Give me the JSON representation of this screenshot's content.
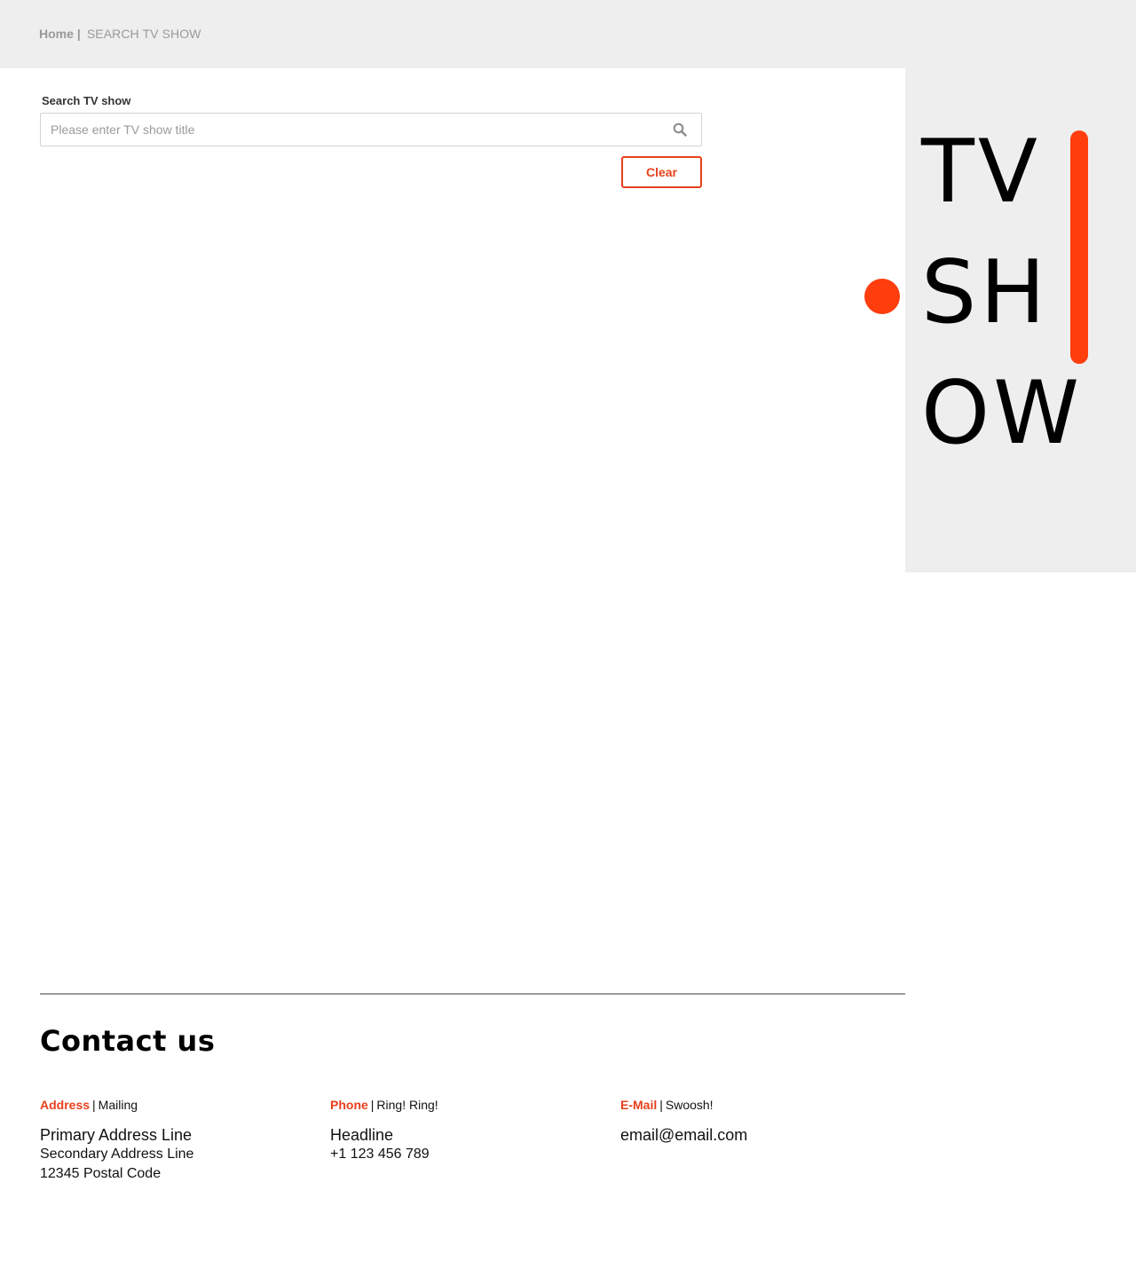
{
  "breadcrumb": {
    "home": "Home",
    "separator": "|",
    "current": "SEARCH TV SHOW"
  },
  "logo": {
    "line1": "TV",
    "line2": "SH",
    "line3": "OW",
    "accent_color": "#ff3d0d"
  },
  "search": {
    "label": "Search TV show",
    "placeholder": "Please enter TV show title",
    "value": "",
    "icon": "search-icon",
    "clear_label": "Clear"
  },
  "footer": {
    "title": "Contact us",
    "address": {
      "key": "Address",
      "tag": "Mailing",
      "line1": "Primary Address Line",
      "line2": "Secondary Address Line",
      "line3": "12345 Postal Code"
    },
    "phone": {
      "key": "Phone",
      "tag": "Ring! Ring!",
      "line1": "Headline",
      "line2": "+1 123 456 789"
    },
    "email": {
      "key": "E-Mail",
      "tag": "Swoosh!",
      "line1": "email@email.com"
    }
  },
  "colors": {
    "accent": "#e8401c",
    "panel_bg": "#eeeeee",
    "muted_text": "#9a9a9a"
  }
}
